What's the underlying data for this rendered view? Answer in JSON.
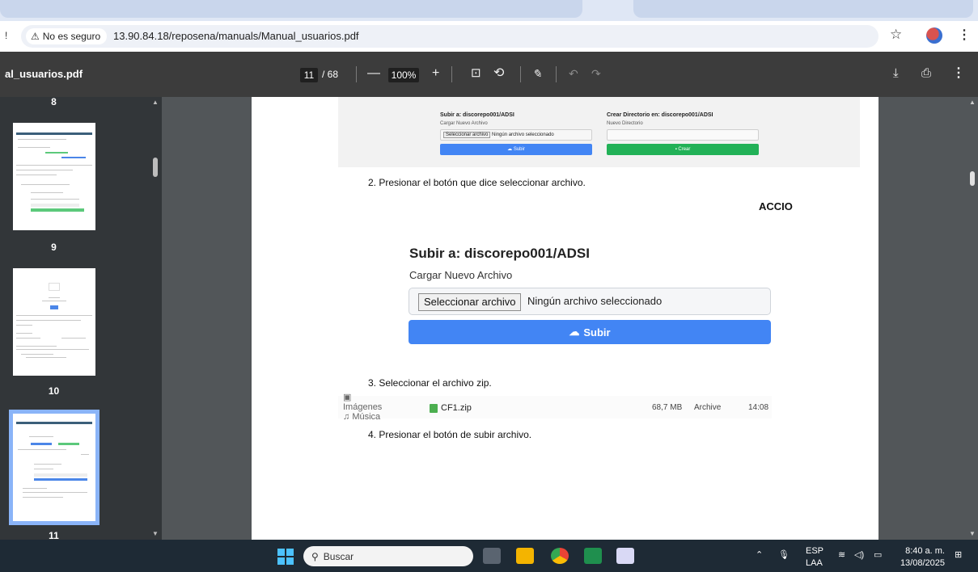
{
  "browser": {
    "security_label": "No es seguro",
    "url": "13.90.84.18/reposena/manuals/Manual_usuarios.pdf",
    "left_edge_glyph": "!"
  },
  "pdf_toolbar": {
    "title": "al_usuarios.pdf",
    "current_page": "11",
    "total_pages": "/ 68",
    "zoom": "100%",
    "minus": "—",
    "plus": "+"
  },
  "sidebar": {
    "thumbnails": [
      {
        "label": "8"
      },
      {
        "label": "9"
      },
      {
        "label": "10"
      },
      {
        "label": "11"
      }
    ]
  },
  "document": {
    "shot1": {
      "left_title": "Subir a: discorepo001/ADSI",
      "left_label": "Cargar Nuevo Archivo",
      "file_button": "Seleccionar archivo",
      "file_text": "Ningún archivo seleccionado",
      "submit": "Subir",
      "right_title": "Crear Directorio en: discorepo001/ADSI",
      "right_label": "Nuevo Directorio",
      "create": "Crear"
    },
    "step2": "2.   Presionar el botón que dice seleccionar archivo.",
    "accio": "ACCIO",
    "upload": {
      "title": "Subir a: discorepo001/ADSI",
      "label": "Cargar Nuevo Archivo",
      "file_button": "Seleccionar archivo",
      "file_text": "Ningún archivo seleccionado",
      "submit": "Subir"
    },
    "step3": "3.   Seleccionar el archivo zip.",
    "file_row": {
      "side_top": "Imágenes",
      "side_bottom": "Música",
      "name": "CF1.zip",
      "size": "68,7 MB",
      "type": "Archive",
      "time": "14:08"
    },
    "step4": "4.   Presionar el botón de subir archivo."
  },
  "taskbar": {
    "search_placeholder": "Buscar",
    "lang_top": "ESP",
    "lang_bottom": "LAA",
    "time": "8:40 a. m.",
    "date": "13/08/2025"
  }
}
